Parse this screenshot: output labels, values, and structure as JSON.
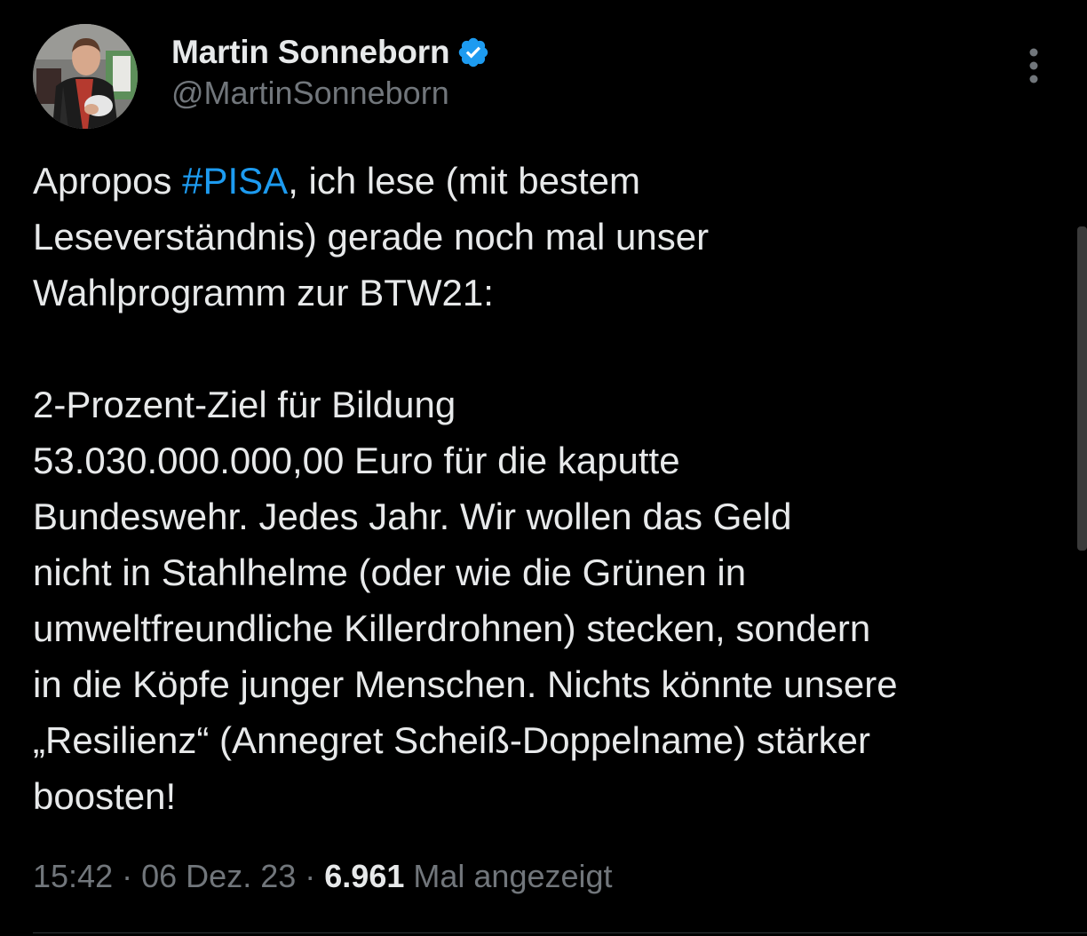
{
  "colors": {
    "background": "#000000",
    "text": "#e7e9ea",
    "secondary": "#71767b",
    "accent": "#1d9bf0"
  },
  "author": {
    "name": "Martin Sonneborn",
    "handle": "@MartinSonneborn",
    "verified": true,
    "avatar_icon": "profile-photo"
  },
  "menu_icon": "more-vertical-icon",
  "tweet": {
    "intro_before": "Apropos ",
    "hashtag": "#PISA",
    "intro_after": ", ich lese (mit bestem\nLeseverständnis) gerade noch mal unser\nWahlprogramm zur BTW21:\n\n2-Prozent-Ziel für Bildung\n53.030.000.000,00 Euro für die kaputte\nBundeswehr. Jedes Jahr. Wir wollen das Geld\nnicht in Stahlhelme (oder wie die Grünen in\numweltfreundliche Killerdrohnen) stecken, sondern\nin die Köpfe junger Menschen. Nichts könnte unsere\n„Resilienz“ (Annegret Scheiß-Doppelname) stärker\nboosten!"
  },
  "meta": {
    "time": "15:42",
    "date": "06 Dez. 23",
    "separator": "·",
    "views": "6.961",
    "views_label": "Mal angezeigt"
  }
}
